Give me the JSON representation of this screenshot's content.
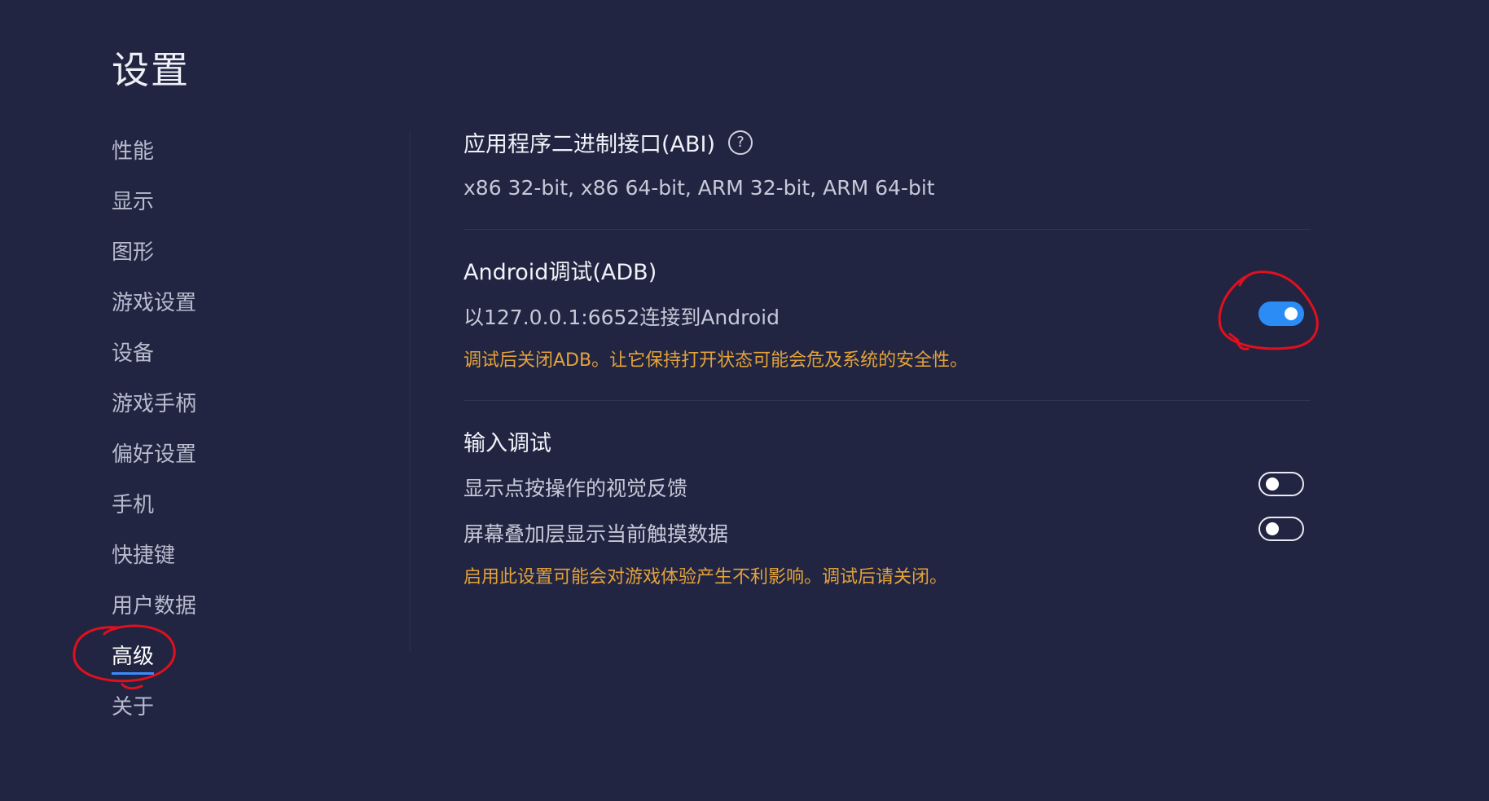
{
  "page": {
    "title": "设置"
  },
  "sidebar": {
    "items": [
      {
        "label": "性能"
      },
      {
        "label": "显示"
      },
      {
        "label": "图形"
      },
      {
        "label": "游戏设置"
      },
      {
        "label": "设备"
      },
      {
        "label": "游戏手柄"
      },
      {
        "label": "偏好设置"
      },
      {
        "label": "手机"
      },
      {
        "label": "快捷键"
      },
      {
        "label": "用户数据"
      },
      {
        "label": "高级",
        "active": true
      },
      {
        "label": "关于"
      }
    ]
  },
  "abi": {
    "heading": "应用程序二进制接口(ABI)",
    "help_icon": "?",
    "value": "x86 32-bit, x86 64-bit, ARM 32-bit, ARM 64-bit"
  },
  "adb": {
    "heading": "Android调试(ADB)",
    "description": "以127.0.0.1:6652连接到Android",
    "toggle_on": true,
    "warning": "调试后关闭ADB。让它保持打开状态可能会危及系统的安全性。"
  },
  "input_debug": {
    "heading": "输入调试",
    "options": [
      {
        "label": "显示点按操作的视觉反馈",
        "toggle_on": false
      },
      {
        "label": "屏幕叠加层显示当前触摸数据",
        "toggle_on": false
      }
    ],
    "warning": "启用此设置可能会对游戏体验产生不利影响。调试后请关闭。"
  },
  "colors": {
    "background": "#212541",
    "accent": "#2b8cf5",
    "warning": "#e3a23b",
    "annotation": "#e0101f"
  }
}
